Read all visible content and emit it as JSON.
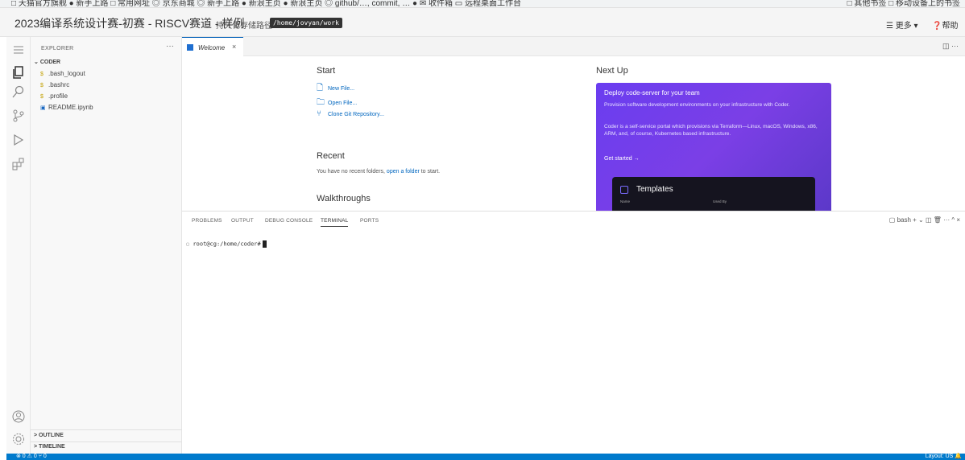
{
  "bookmarks": {
    "left_text": "□ 天猫官方旗舰  ● 新手上路  □ 常用网址  ◎ 京东商城  ◎ 新手上路  ● 新浪主页  ● 新浪主页  ◎ github/…, commit, …  ●        ✉ 收件箱  ▭ 远程桌面工作台",
    "right_text": "□ 其他书签  □ 移动设备上的书签"
  },
  "header": {
    "title": "2023编译系统设计赛-初赛 - RISCV赛道 - 样例",
    "path_label": "持久化存储路径:",
    "path_value": "/home/jovyan/work",
    "more_label": "☰ 更多 ▾",
    "help_label": "❓帮助"
  },
  "sidebar": {
    "title": "EXPLORER",
    "more": "···",
    "folder": "CODER",
    "files": [
      {
        "icon": "$",
        "name": ".bash_logout"
      },
      {
        "icon": "$",
        "name": ".bashrc"
      },
      {
        "icon": "$",
        "name": ".profile"
      },
      {
        "icon": "▣",
        "name": "README.ipynb"
      }
    ],
    "outline": "OUTLINE",
    "timeline": "TIMELINE"
  },
  "tabs": {
    "active": "Welcome",
    "close": "×",
    "actions": "◫  ···"
  },
  "welcome": {
    "start": "Start",
    "new_file": "New File...",
    "open_file": "Open File...",
    "clone_repo": "Clone Git Repository...",
    "recent": "Recent",
    "recent_text": "You have no recent folders, ",
    "recent_link": "open a folder",
    "recent_text_after": " to start.",
    "walkthroughs": "Walkthroughs",
    "next_up": "Next Up",
    "card": {
      "title": "Deploy code-server for your team",
      "p1": "Provision software development environments on your infrastructure with Coder.",
      "p2": "Coder is a self-service portal which provisions via Terraform—Linux, macOS, Windows, x86, ARM, and, of course, Kubernetes based infrastructure.",
      "cta": "Get started  →",
      "templates_title": "Templates",
      "col_name": "Name",
      "col_used": "Used By"
    }
  },
  "panel": {
    "tabs": [
      "PROBLEMS",
      "OUTPUT",
      "DEBUG CONSOLE",
      "TERMINAL",
      "PORTS"
    ],
    "active_tab": "TERMINAL",
    "actions": "▢ bash  +  ⌄  ◫  🗑  ···  ^  ×",
    "prompt": "root@cg:/home/coder#"
  },
  "status": {
    "left": "⊗ 0 ⚠ 0   ⑂ 0",
    "right": "Layout: US  🔔"
  }
}
